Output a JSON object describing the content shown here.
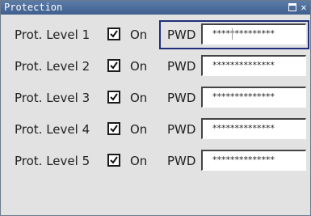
{
  "window": {
    "title": "Protection"
  },
  "rows": [
    {
      "label": "Prot. Level 1",
      "on_label": "On",
      "pwd_label": "PWD",
      "password": "**************",
      "checked": true
    },
    {
      "label": "Prot. Level 2",
      "on_label": "On",
      "pwd_label": "PWD",
      "password": "**************",
      "checked": true
    },
    {
      "label": "Prot. Level 3",
      "on_label": "On",
      "pwd_label": "PWD",
      "password": "**************",
      "checked": true
    },
    {
      "label": "Prot. Level 4",
      "on_label": "On",
      "pwd_label": "PWD",
      "password": "**************",
      "checked": true
    },
    {
      "label": "Prot. Level 5",
      "on_label": "On",
      "pwd_label": "PWD",
      "password": "**************",
      "checked": true
    }
  ],
  "icons": {
    "maximize": "maximize-icon",
    "close": "close-icon",
    "check": "checkmark-icon"
  }
}
